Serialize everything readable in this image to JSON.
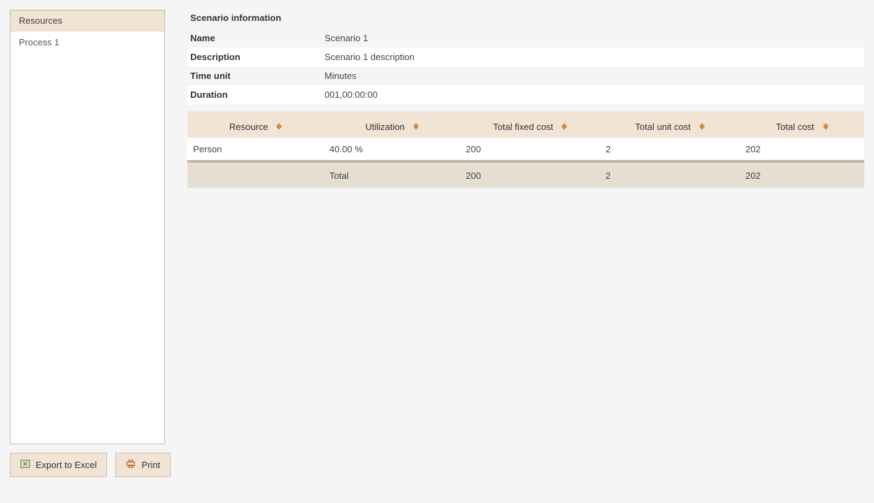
{
  "sidebar": {
    "header": "Resources",
    "items": [
      {
        "label": "Process 1"
      }
    ]
  },
  "buttons": {
    "export": "Export to Excel",
    "print": "Print"
  },
  "info": {
    "title": "Scenario information",
    "rows": [
      {
        "label": "Name",
        "value": "Scenario 1"
      },
      {
        "label": "Description",
        "value": "Scenario 1 description"
      },
      {
        "label": "Time unit",
        "value": "Minutes"
      },
      {
        "label": "Duration",
        "value": "001,00:00:00"
      }
    ]
  },
  "table": {
    "headers": {
      "resource": "Resource",
      "utilization": "Utilization",
      "total_fixed_cost": "Total fixed cost",
      "total_unit_cost": "Total unit cost",
      "total_cost": "Total cost"
    },
    "rows": [
      {
        "resource": "Person",
        "utilization": "40.00 %",
        "fixed": "200",
        "unit": "2",
        "total": "202"
      }
    ],
    "footer": {
      "label": "Total",
      "fixed": "200",
      "unit": "2",
      "total": "202"
    }
  }
}
